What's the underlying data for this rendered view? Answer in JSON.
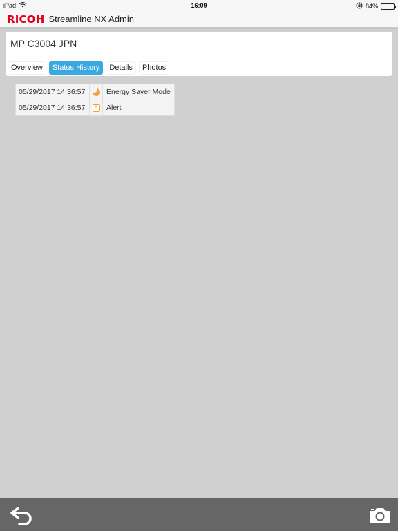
{
  "status_bar": {
    "device": "iPad",
    "time": "16:09",
    "battery": "84%",
    "battery_level": 0.84,
    "icons": [
      "wifi-icon",
      "rotation-lock-icon",
      "battery-icon"
    ]
  },
  "app": {
    "brand": "RICOH",
    "title": "Streamline NX Admin",
    "brand_color": "#e0001b"
  },
  "device": {
    "name": "MP C3004 JPN"
  },
  "tabs": [
    {
      "label": "Overview",
      "active": false
    },
    {
      "label": "Status History",
      "active": true
    },
    {
      "label": "Details",
      "active": false
    },
    {
      "label": "Photos",
      "active": false
    }
  ],
  "history": [
    {
      "timestamp": "05/29/2017 14:36:57",
      "icon": "moon-icon",
      "status": "Energy Saver Mode"
    },
    {
      "timestamp": "05/29/2017 14:36:57",
      "icon": "alert-icon",
      "status": "Alert"
    }
  ],
  "toolbar": {
    "icons": [
      "back-arrow-icon",
      "camera-icon"
    ]
  },
  "colors": {
    "accent": "#3aa9e0",
    "status_icon": "#f2a23c",
    "background": "#d0d0d0",
    "bottom_bar": "#666666"
  }
}
